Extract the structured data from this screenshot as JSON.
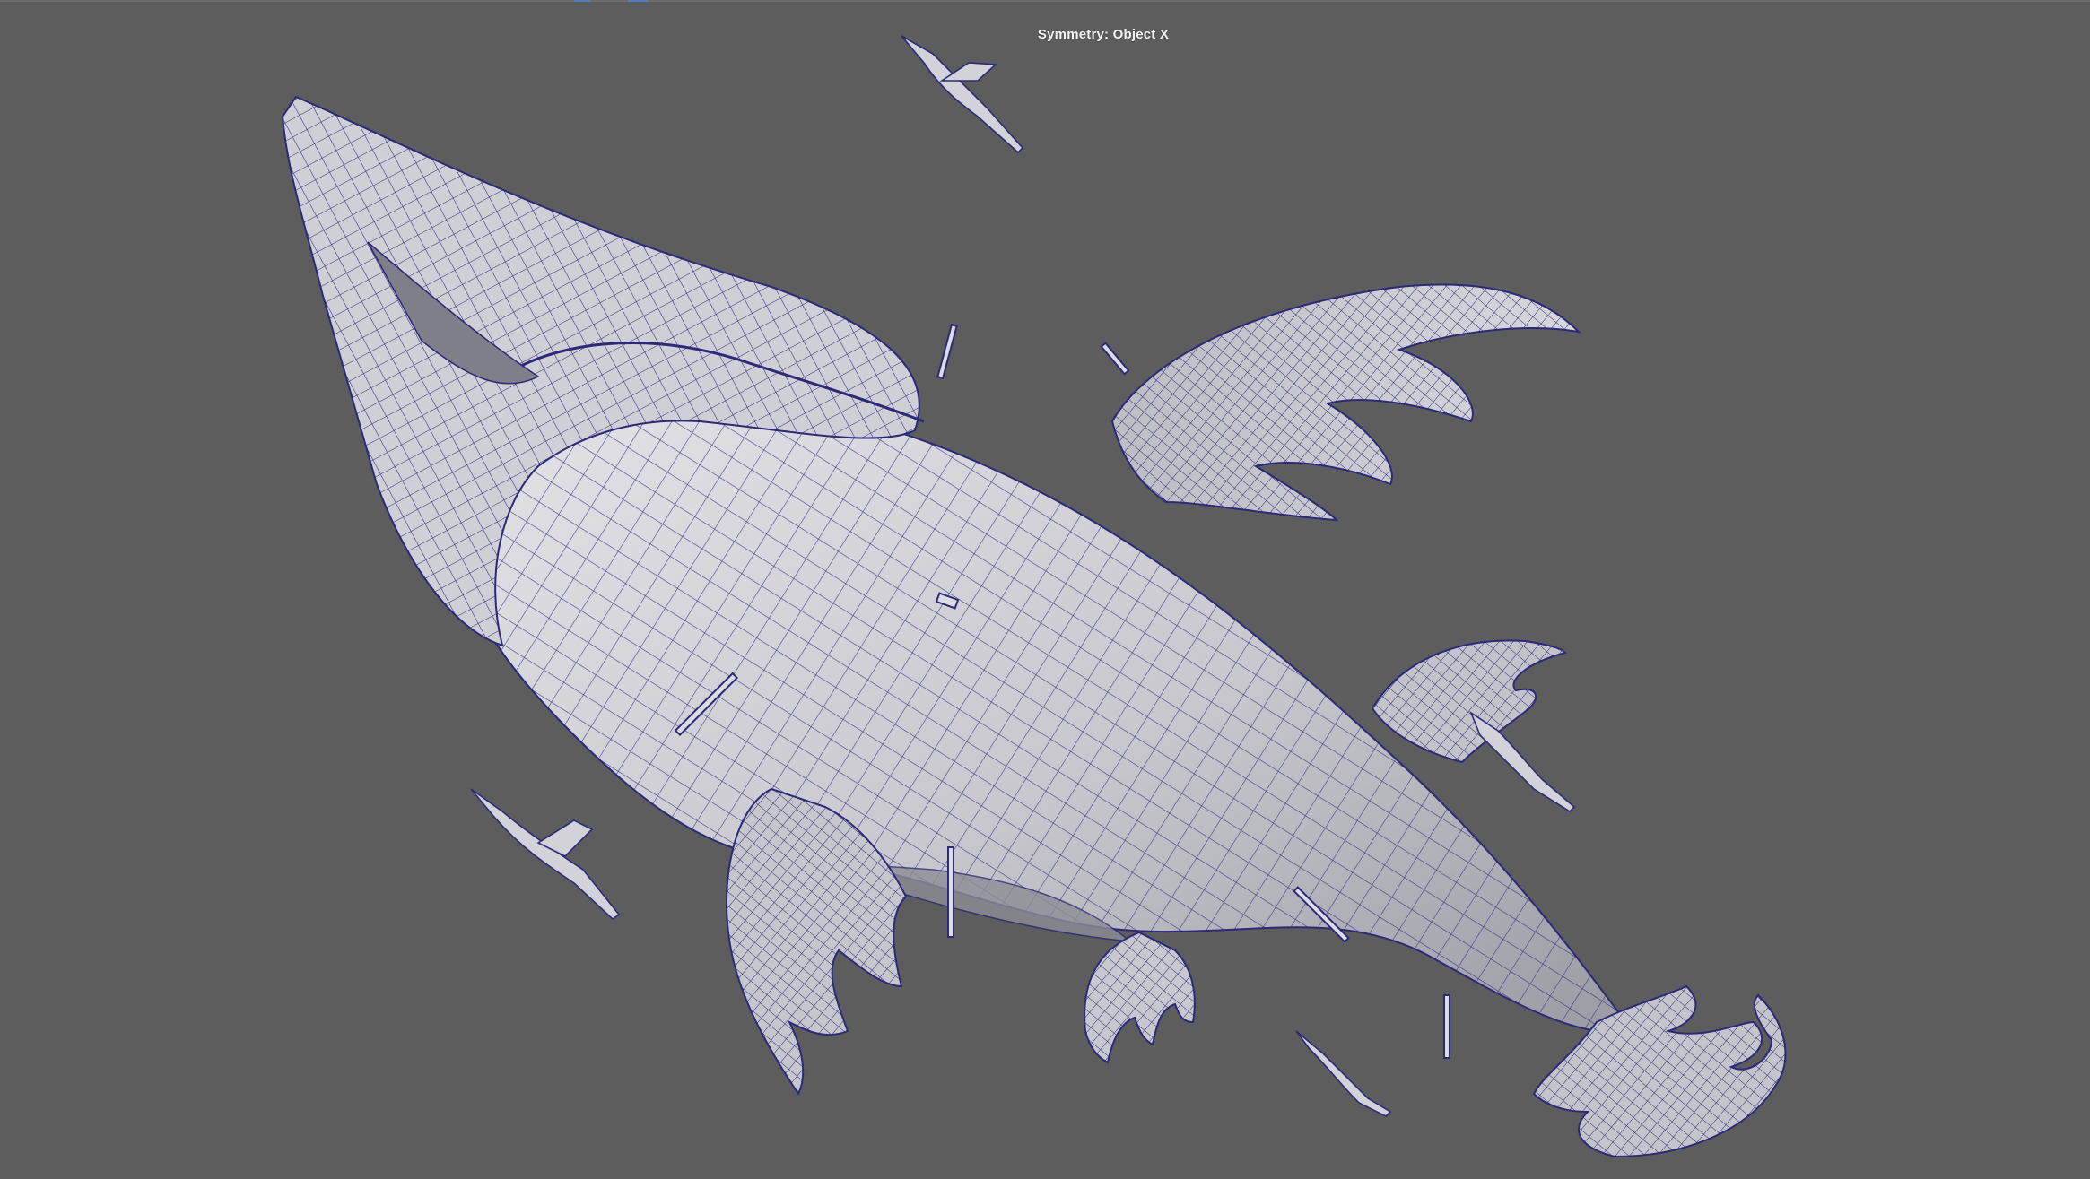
{
  "viewport": {
    "hud_text": "Symmetry: Object X",
    "background_color": "#5d5d5d",
    "wire_color": "#2a2a78",
    "surface_light": "#d9d9de",
    "surface_mid": "#b9b9c0",
    "surface_dark": "#8f8f98"
  },
  "scene": {
    "subject": "dragon-mesh",
    "parts": [
      "head",
      "neck",
      "torso",
      "left-wing",
      "right-wing",
      "tail",
      "tail-claw",
      "front-leg",
      "hind-leg",
      "spines"
    ],
    "small_creatures": 4
  }
}
